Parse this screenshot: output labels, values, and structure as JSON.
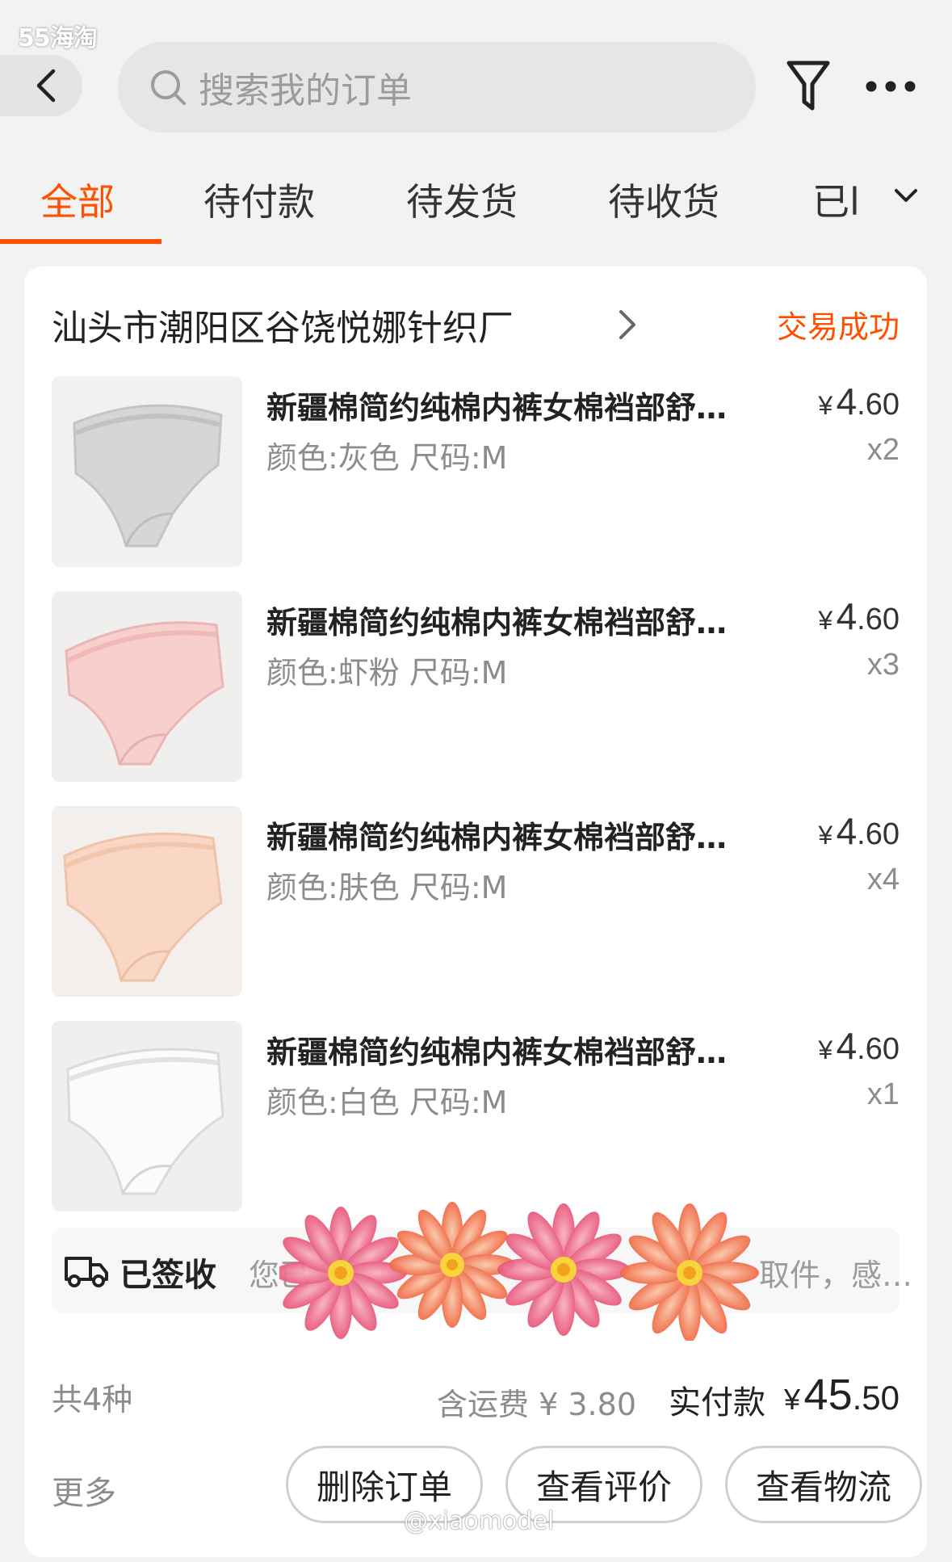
{
  "watermark_top": "55海淘",
  "watermark_bottom": "@xiaomodel",
  "search": {
    "placeholder": "搜索我的订单"
  },
  "icons": {
    "back": "chevron-left-icon",
    "search": "search-icon",
    "filter": "filter-icon",
    "more": "more-dots-icon",
    "tab_expand": "chevron-down-icon",
    "shop_arrow": "chevron-right-icon",
    "logistics": "truck-icon"
  },
  "colors": {
    "accent": "#ff5000",
    "muted": "#8c8c8c",
    "background": "#f2f2f2"
  },
  "tabs": [
    {
      "label": "全部",
      "active": true
    },
    {
      "label": "待付款",
      "active": false
    },
    {
      "label": "待发货",
      "active": false
    },
    {
      "label": "待收货",
      "active": false
    },
    {
      "label": "已l",
      "active": false
    }
  ],
  "order": {
    "shop_name": "汕头市潮阳区谷饶悦娜针织厂",
    "status": "交易成功",
    "items": [
      {
        "title": "新疆棉简约纯棉内裤女棉裆部舒…",
        "spec": "颜色:灰色 尺码:M",
        "price_currency": "¥",
        "price_int": "4",
        "price_dec": ".60",
        "qty": "x2",
        "swatch": "#d9d9d9"
      },
      {
        "title": "新疆棉简约纯棉内裤女棉裆部舒…",
        "spec": "颜色:虾粉 尺码:M",
        "price_currency": "¥",
        "price_int": "4",
        "price_dec": ".60",
        "qty": "x3",
        "swatch": "#f7cfcd"
      },
      {
        "title": "新疆棉简约纯棉内裤女棉裆部舒…",
        "spec": "颜色:肤色 尺码:M",
        "price_currency": "¥",
        "price_int": "4",
        "price_dec": ".60",
        "qty": "x4",
        "swatch": "#f9d7c4"
      },
      {
        "title": "新疆棉简约纯棉内裤女棉裆部舒…",
        "spec": "颜色:白色 尺码:M",
        "price_currency": "¥",
        "price_int": "4",
        "price_dec": ".60",
        "qty": "x1",
        "swatch": "#f6f6f6"
      }
    ],
    "logistics": {
      "status": "已签收",
      "text_left": "您已",
      "text_right": "取件，感…"
    },
    "summary": {
      "kinds": "共4种",
      "shipping": "含运费 ¥ 3.80",
      "paid_label": "实付款",
      "paid_currency": "¥",
      "paid_int": "45",
      "paid_dec": ".50"
    },
    "actions": {
      "more": "更多",
      "delete": "删除订单",
      "review": "查看评价",
      "track": "查看物流"
    }
  }
}
